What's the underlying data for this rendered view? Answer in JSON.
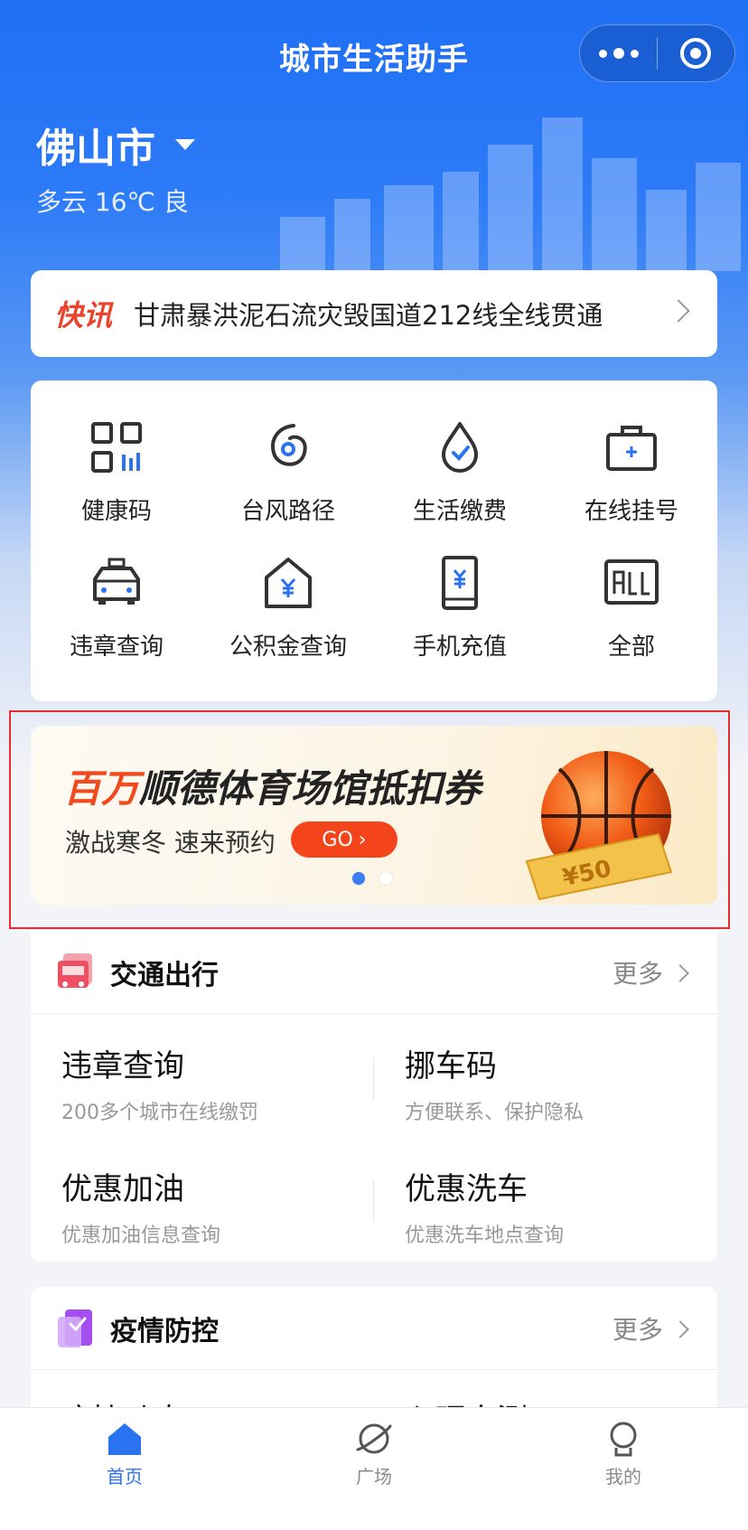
{
  "header": {
    "title": "城市生活助手",
    "capsule_more": "more-icon",
    "capsule_close": "target-icon"
  },
  "location": {
    "city": "佛山市",
    "weather": "多云 16℃ 良"
  },
  "news": {
    "tag": "快讯",
    "headline": "甘肃暴洪泥石流灾毁国道212线全线贯通"
  },
  "services": [
    {
      "label": "健康码",
      "icon": "qrcode-icon"
    },
    {
      "label": "台风路径",
      "icon": "typhoon-icon"
    },
    {
      "label": "生活缴费",
      "icon": "water-drop-icon"
    },
    {
      "label": "在线挂号",
      "icon": "medical-kit-icon"
    },
    {
      "label": "违章查询",
      "icon": "taxi-icon"
    },
    {
      "label": "公积金查询",
      "icon": "house-yuan-icon"
    },
    {
      "label": "手机充值",
      "icon": "phone-yuan-icon"
    },
    {
      "label": "全部",
      "icon": "all-icon"
    }
  ],
  "banner": {
    "headline_accent": "百万",
    "headline_rest": "顺德体育场馆抵扣券",
    "subtitle": "激战寒冬 速来预约",
    "cta": "GO",
    "coupon_text": "¥50",
    "slides_total": 2,
    "slide_active": 1
  },
  "traffic": {
    "title": "交通出行",
    "more": "更多",
    "items": [
      {
        "title": "违章查询",
        "desc": "200多个城市在线缴罚"
      },
      {
        "title": "挪车码",
        "desc": "方便联系、保护隐私"
      },
      {
        "title": "优惠加油",
        "desc": "优惠加油信息查询"
      },
      {
        "title": "优惠洗车",
        "desc": "优惠洗车地点查询"
      }
    ]
  },
  "epidemic": {
    "title": "疫情防控",
    "more": "更多",
    "items": [
      {
        "title": "疫情动态"
      },
      {
        "title": "心理自测"
      }
    ]
  },
  "tabbar": [
    {
      "label": "首页",
      "icon": "home-icon",
      "active": true
    },
    {
      "label": "广场",
      "icon": "planet-icon",
      "active": false
    },
    {
      "label": "我的",
      "icon": "user-icon",
      "active": false
    }
  ],
  "colors": {
    "primary": "#1f6ff5",
    "accent_red": "#e9432c",
    "cta_orange": "#f4441c",
    "highlight_frame": "#e52d2d"
  }
}
